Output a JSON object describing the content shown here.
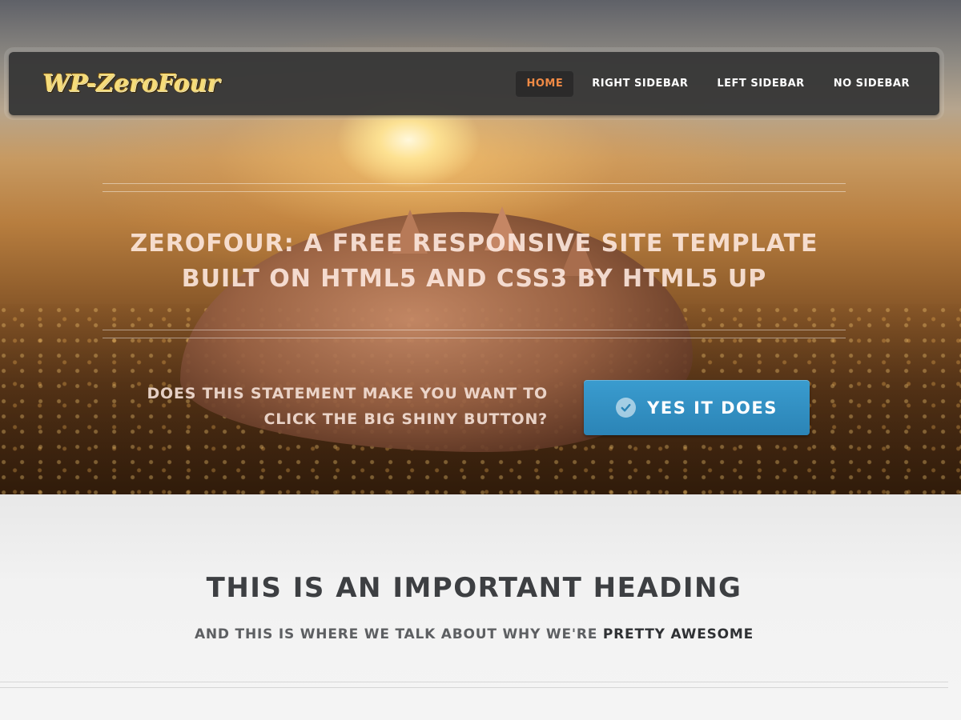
{
  "site": {
    "logo_text": "WP-ZeroFour"
  },
  "nav": {
    "items": [
      {
        "label": "HOME",
        "active": true
      },
      {
        "label": "RIGHT SIDEBAR",
        "active": false
      },
      {
        "label": "LEFT SIDEBAR",
        "active": false
      },
      {
        "label": "NO SIDEBAR",
        "active": false
      }
    ]
  },
  "hero": {
    "tagline_line1": "ZEROFOUR: A FREE RESPONSIVE SITE TEMPLATE",
    "tagline_line2": "BUILT ON HTML5 AND CSS3 BY HTML5 UP",
    "cta_text_line1": "DOES THIS STATEMENT MAKE YOU WANT TO",
    "cta_text_line2": "CLICK THE BIG SHINY BUTTON?",
    "cta_button_label": "YES IT DOES",
    "cta_button_icon": "check-circle-icon",
    "accent_color": "#2f8bc0"
  },
  "intro": {
    "heading": "THIS IS AN IMPORTANT HEADING",
    "subheading_prefix": "AND THIS IS WHERE WE TALK ABOUT WHY WE'RE ",
    "subheading_emphasis": "PRETTY AWESOME"
  },
  "colors": {
    "nav_active": "#f08a45",
    "nav_bg": "#373737"
  }
}
